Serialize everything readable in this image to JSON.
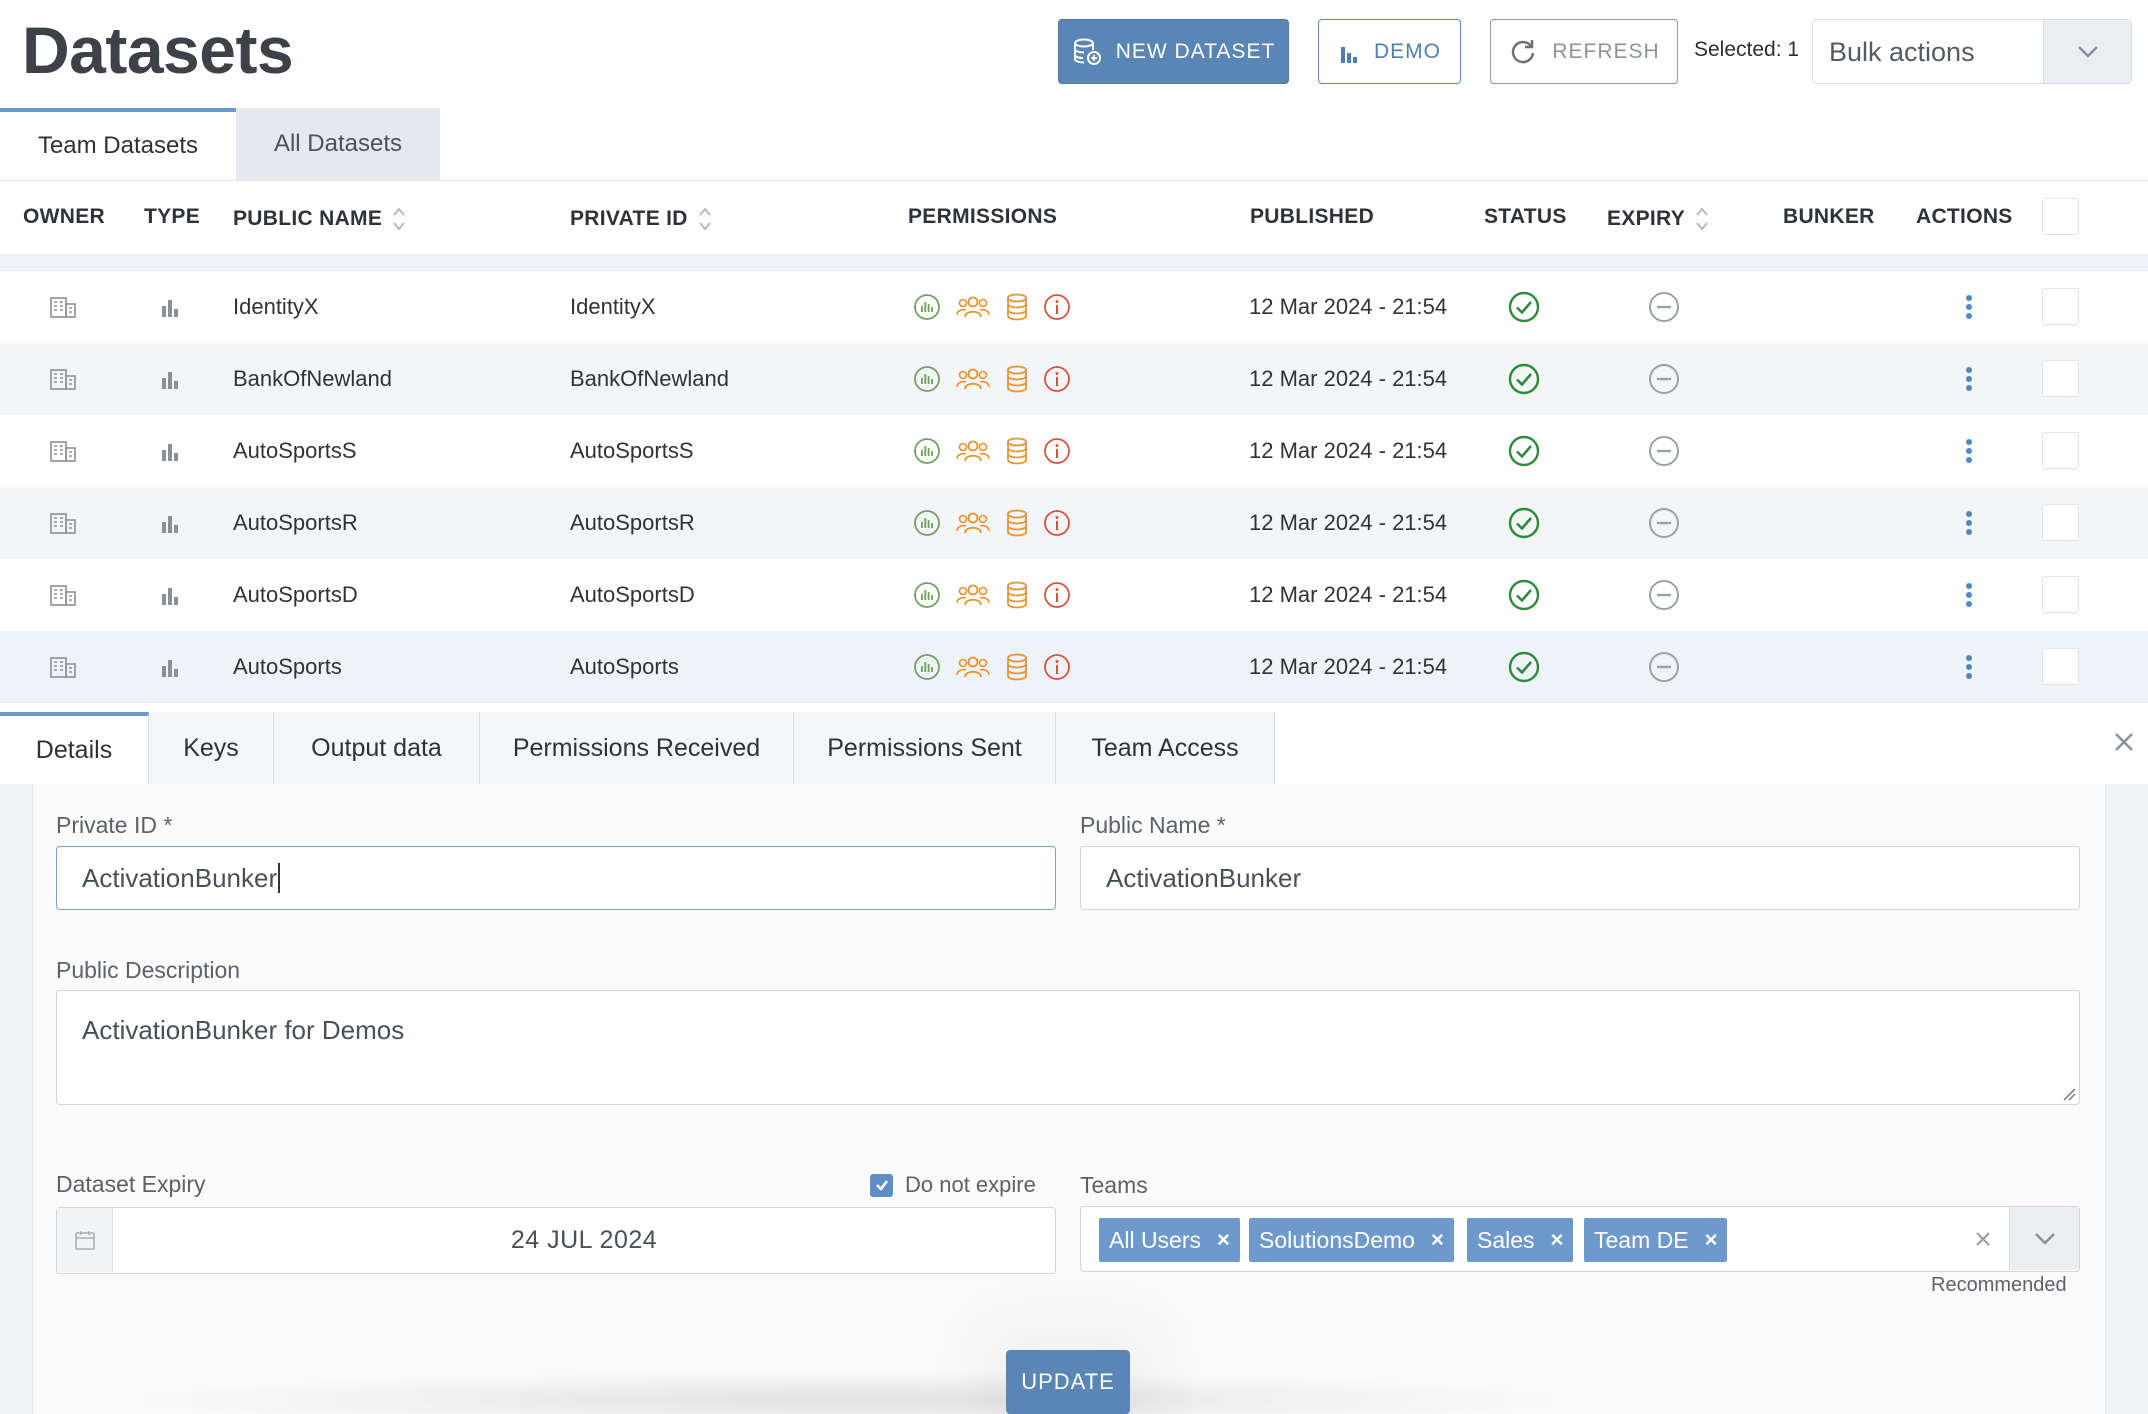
{
  "page": {
    "title": "Datasets"
  },
  "toolbar": {
    "new_dataset_label": "NEW DATASET",
    "demo_label": "DEMO",
    "refresh_label": "REFRESH",
    "selected_label": "Selected: 1",
    "bulk_actions_value": "Bulk actions"
  },
  "dataset_tabs": [
    {
      "label": "Team Datasets",
      "active": true
    },
    {
      "label": "All Datasets",
      "active": false
    }
  ],
  "table": {
    "columns": {
      "owner": "OWNER",
      "type": "TYPE",
      "public_name": "PUBLIC NAME",
      "private_id": "PRIVATE ID",
      "permissions": "PERMISSIONS",
      "published": "PUBLISHED",
      "status": "STATUS",
      "expiry": "EXPIRY",
      "bunker": "BUNKER",
      "actions": "ACTIONS"
    },
    "rows": [
      {
        "public_name": "IdentityX",
        "private_id": "IdentityX",
        "published": "12 Mar 2024 - 21:54"
      },
      {
        "public_name": "BankOfNewland",
        "private_id": "BankOfNewland",
        "published": "12 Mar 2024 - 21:54"
      },
      {
        "public_name": "AutoSportsS",
        "private_id": "AutoSportsS",
        "published": "12 Mar 2024 - 21:54"
      },
      {
        "public_name": "AutoSportsR",
        "private_id": "AutoSportsR",
        "published": "12 Mar 2024 - 21:54"
      },
      {
        "public_name": "AutoSportsD",
        "private_id": "AutoSportsD",
        "published": "12 Mar 2024 - 21:54"
      },
      {
        "public_name": "AutoSports",
        "private_id": "AutoSports",
        "published": "12 Mar 2024 - 21:54"
      }
    ]
  },
  "icons": {
    "owner": "building-icon",
    "type": "bar-chart-icon",
    "perm_analytics": "analytics-circle-icon",
    "perm_users": "users-icon",
    "perm_database": "database-icon",
    "perm_info": "info-circle-icon",
    "status": "check-circle-icon",
    "expiry": "minus-circle-icon",
    "actions": "more-vertical-icon"
  },
  "colors": {
    "primary": "#5a86b5",
    "status_ok": "#2e8b3a",
    "perm_green": "#6ea25c",
    "perm_orange": "#e8932e",
    "perm_red": "#d9503c",
    "chip": "#6d99cd"
  },
  "detail_tabs": [
    {
      "label": "Details",
      "active": true
    },
    {
      "label": "Keys"
    },
    {
      "label": "Output data"
    },
    {
      "label": "Permissions Received"
    },
    {
      "label": "Permissions Sent"
    },
    {
      "label": "Team Access"
    }
  ],
  "form": {
    "private_id_label": "Private ID *",
    "private_id_value": "ActivationBunker",
    "public_name_label": "Public Name *",
    "public_name_value": "ActivationBunker",
    "public_description_label": "Public Description",
    "public_description_value": "ActivationBunker for Demos",
    "expiry_label": "Dataset Expiry",
    "do_not_expire_label": "Do not expire",
    "do_not_expire_checked": true,
    "expiry_value": "24 JUL 2024",
    "teams_label": "Teams",
    "teams": [
      "All Users",
      "SolutionsDemo",
      "Sales",
      "Team DE"
    ],
    "recommended_label": "Recommended",
    "update_label": "UPDATE"
  }
}
